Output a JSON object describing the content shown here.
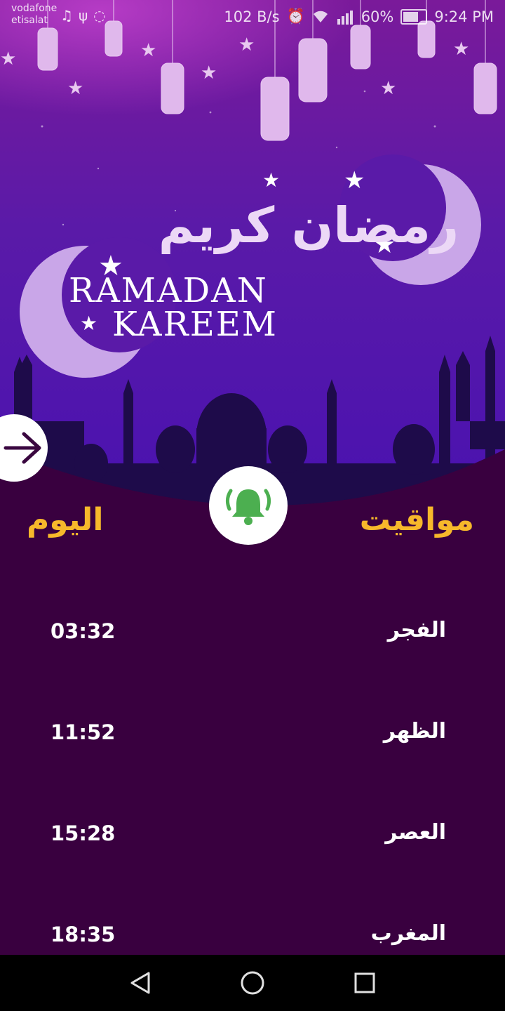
{
  "status_bar": {
    "carrier_1": "vodafone",
    "carrier_2": "etisalat",
    "speed": "102 B/s",
    "battery": "60%",
    "time": "9:24 PM",
    "icons": [
      "music-icon",
      "usb-icon",
      "whatsapp-icon",
      "alarm-icon",
      "wifi-icon",
      "signal-icon",
      "battery-icon"
    ]
  },
  "banner": {
    "arabic_title": "رمضان كريم",
    "latin_line_1": "RAMADAN",
    "latin_line_2": "KAREEM"
  },
  "header": {
    "title_right": "مواقيت",
    "title_left": "اليوم"
  },
  "colors": {
    "background": "#39003f",
    "accent": "#f7b82b",
    "bell_green": "#4caf50"
  },
  "prayers": [
    {
      "name": "الفجر",
      "time": "03:32"
    },
    {
      "name": "الظهر",
      "time": "11:52"
    },
    {
      "name": "العصر",
      "time": "15:28"
    },
    {
      "name": "المغرب",
      "time": "18:35"
    }
  ],
  "nav": {
    "icons": [
      "back-icon",
      "home-icon",
      "recents-icon"
    ]
  }
}
